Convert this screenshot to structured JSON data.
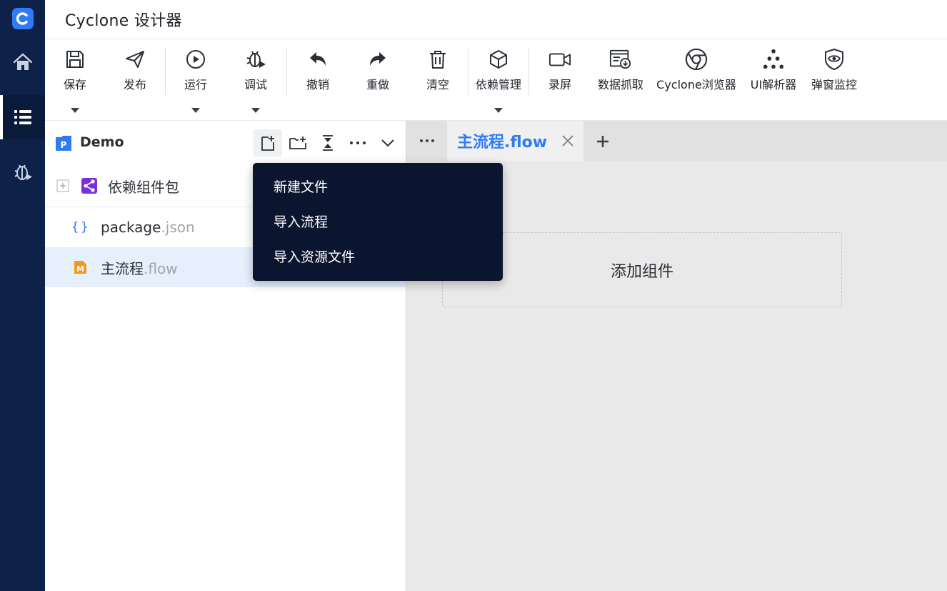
{
  "app": {
    "title": "Cyclone 设计器",
    "logo_letter": "C"
  },
  "rail": {
    "items": [
      {
        "name": "home-icon"
      },
      {
        "name": "list-icon",
        "active": true
      },
      {
        "name": "debug-icon"
      }
    ]
  },
  "toolbar": {
    "save": "保存",
    "publish": "发布",
    "run": "运行",
    "debug": "调试",
    "undo": "撤销",
    "redo": "重做",
    "clear": "清空",
    "deps": "依赖管理",
    "record": "录屏",
    "scrape": "数据抓取",
    "browser": "Cyclone浏览器",
    "ui_parser": "UI解析器",
    "popup_monitor": "弹窗监控"
  },
  "explorer": {
    "project_badge": "P",
    "project_name": "Demo",
    "tree": [
      {
        "name": "依赖组件包",
        "icon": "share-icon"
      },
      {
        "base": "package",
        "ext": ".json",
        "icon": "braces-icon"
      },
      {
        "base": "主流程",
        "ext": ".flow",
        "icon": "flow-file-icon",
        "badge": "M",
        "selected": true
      }
    ]
  },
  "menu": {
    "items": [
      "新建文件",
      "导入流程",
      "导入资源文件"
    ]
  },
  "editor": {
    "tab_label": "主流程.flow",
    "add_component": "添加组件"
  },
  "colors": {
    "rail": "#0d2149",
    "accent": "#2f7bf5",
    "menu_bg": "#0c1530",
    "selected_row": "#e6f0fd",
    "editor_bg": "#e9e9e9"
  }
}
